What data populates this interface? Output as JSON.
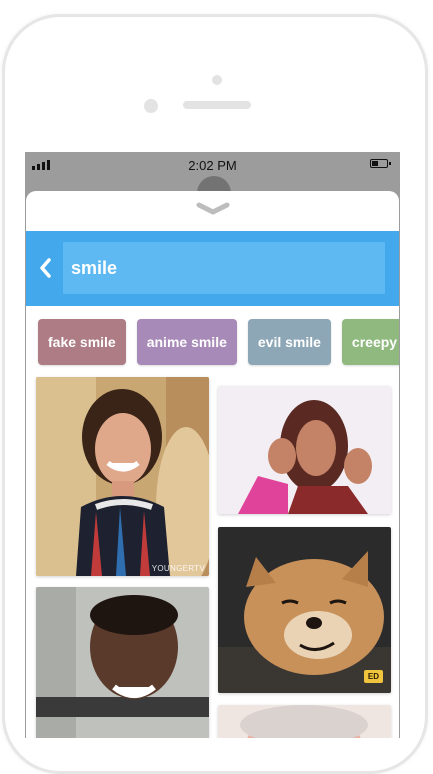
{
  "status": {
    "time": "2:02 PM"
  },
  "search": {
    "query": "smile"
  },
  "chips": [
    {
      "label": "fake smile",
      "color": "#ad7c84"
    },
    {
      "label": "anime smile",
      "color": "#a88ab8"
    },
    {
      "label": "evil smile",
      "color": "#8ea7b6"
    },
    {
      "label": "creepy smile",
      "color": "#8fb97f"
    }
  ],
  "gifs": [
    {
      "watermark": "YOUNGERTV"
    },
    {
      "watermark": ""
    },
    {
      "watermark": ""
    },
    {
      "watermark": "",
      "badge": "ED"
    },
    {
      "watermark": ""
    }
  ],
  "colors": {
    "accent": "#44a8ec",
    "input": "#5eb8f1"
  }
}
